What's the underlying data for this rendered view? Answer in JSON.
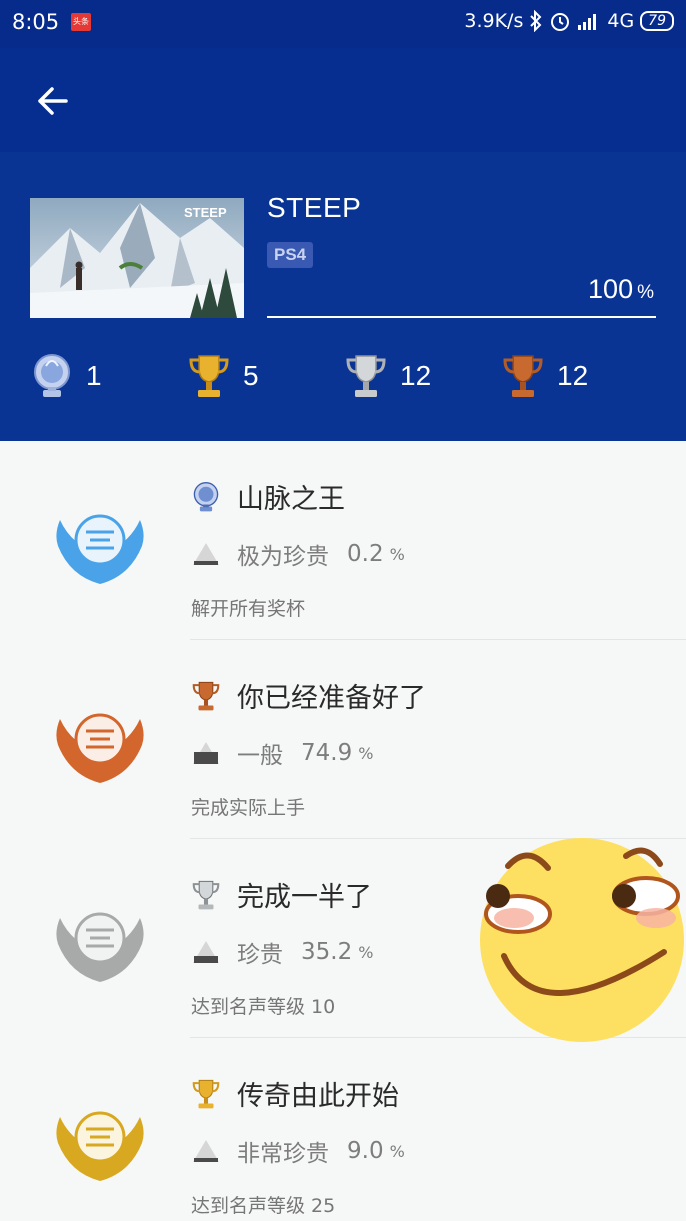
{
  "status_bar": {
    "time": "8:05",
    "app_badge": "头条",
    "network_speed": "3.9K/s",
    "network_type": "4G",
    "battery": "79"
  },
  "game": {
    "title": "STEEP",
    "cover_text": "STEEP",
    "platform": "PS4",
    "progress": "100",
    "progress_unit": "%"
  },
  "counts": {
    "platinum": "1",
    "gold": "5",
    "silver": "12",
    "bronze": "12"
  },
  "trophies": [
    {
      "name": "山脉之王",
      "type": "platinum",
      "rarity": "极为珍贵",
      "percent": "0.2",
      "unit": "%",
      "description": "解开所有奖杯",
      "badge_color": "#4aa3e8"
    },
    {
      "name": "你已经准备好了",
      "type": "bronze",
      "rarity": "一般",
      "percent": "74.9",
      "unit": "%",
      "description": "完成实际上手",
      "badge_color": "#d2662c"
    },
    {
      "name": "完成一半了",
      "type": "silver",
      "rarity": "珍贵",
      "percent": "35.2",
      "unit": "%",
      "description": "达到名声等级 10",
      "badge_color": "#a7aaa9"
    },
    {
      "name": "传奇由此开始",
      "type": "gold",
      "rarity": "非常珍贵",
      "percent": "9.0",
      "unit": "%",
      "description": "达到名声等级 25",
      "badge_color": "#d8a820"
    }
  ],
  "colors": {
    "header_bg": "#0a3494",
    "appbar_bg": "#062e90",
    "platinum": "#9fb6e8",
    "gold": "#e4a92b",
    "silver": "#b9bcbe",
    "bronze": "#c1652d"
  },
  "icons": {
    "back": "arrow-left-icon",
    "platinum": "platinum-trophy-icon",
    "gold": "gold-trophy-icon",
    "silver": "silver-trophy-icon",
    "bronze": "bronze-trophy-icon",
    "rarity": "rarity-pyramid-icon"
  }
}
